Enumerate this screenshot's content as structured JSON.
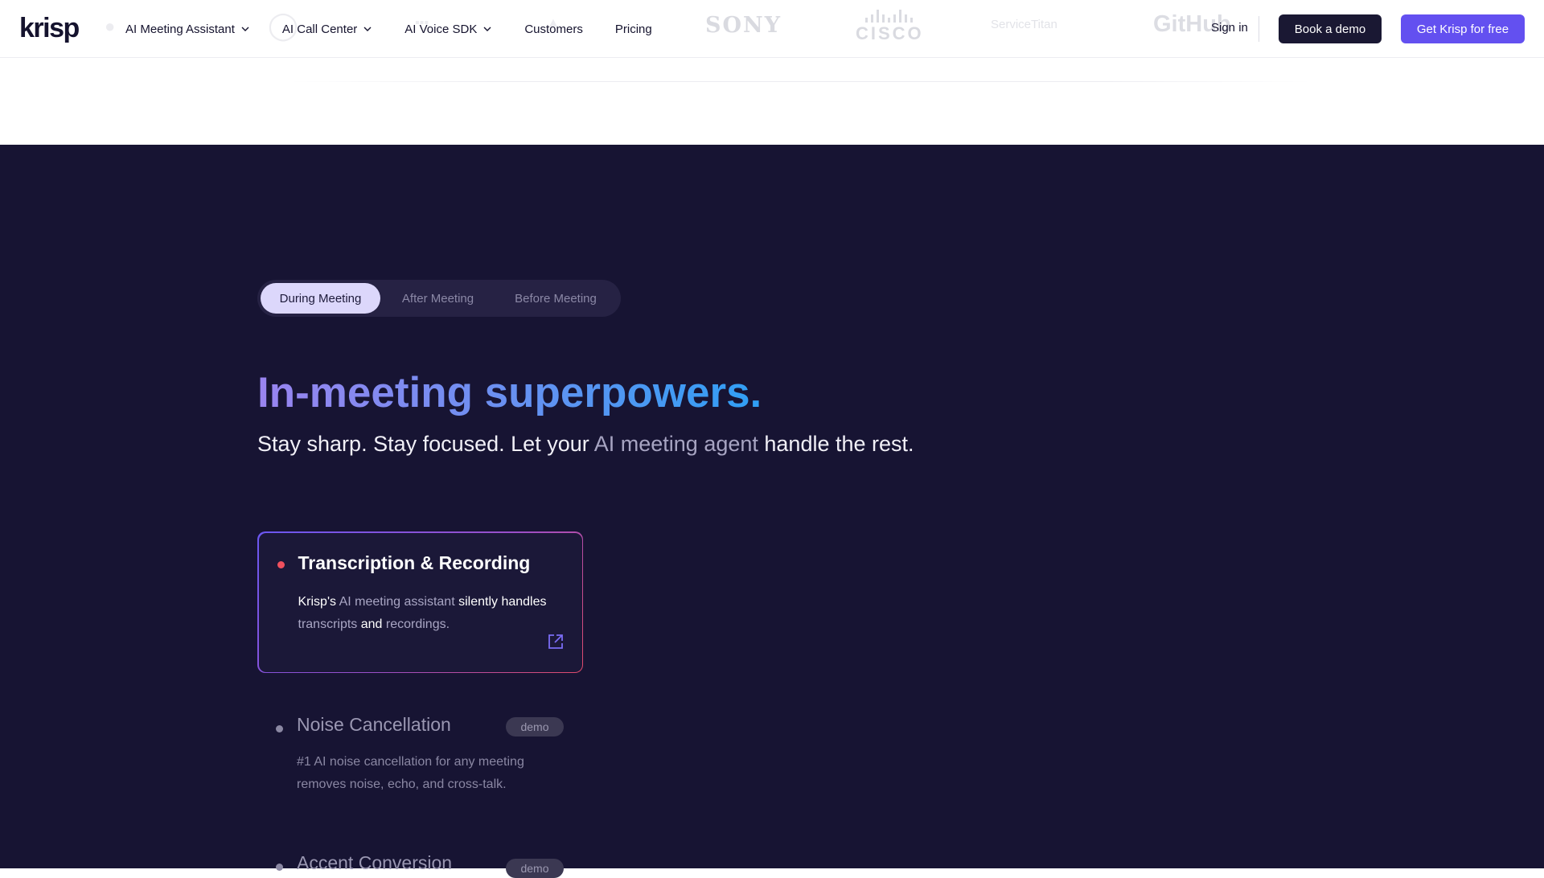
{
  "brand": {
    "logo": "krisp"
  },
  "nav": {
    "items": [
      {
        "label": "AI Meeting Assistant",
        "has_dropdown": true
      },
      {
        "label": "AI Call Center",
        "has_dropdown": true
      },
      {
        "label": "AI Voice SDK",
        "has_dropdown": true
      },
      {
        "label": "Customers",
        "has_dropdown": false
      },
      {
        "label": "Pricing",
        "has_dropdown": false
      }
    ],
    "sign_in": "Sign in",
    "book_demo": "Book a demo",
    "get_free": "Get Krisp for free"
  },
  "customer_logos": [
    "SONY",
    "CISCO",
    "ServiceTitan",
    "GitHub"
  ],
  "tabs": [
    {
      "label": "During Meeting",
      "active": true
    },
    {
      "label": "After Meeting",
      "active": false
    },
    {
      "label": "Before Meeting",
      "active": false
    }
  ],
  "hero": {
    "headline": "In-meeting superpowers.",
    "sub_1": "Stay sharp. Stay focused. Let your ",
    "sub_dim": "AI meeting agent",
    "sub_2": " handle the rest."
  },
  "features": [
    {
      "title": "Transcription & Recording",
      "desc_parts": [
        "Krisp's",
        " AI meeting assistant ",
        "silently handles",
        " transcripts ",
        "and",
        " recordings."
      ],
      "active": true,
      "icon": "external-link-icon"
    },
    {
      "title": "Noise Cancellation",
      "badge": "demo",
      "desc": "#1 AI noise cancellation for any meeting removes noise, echo, and cross-talk.",
      "active": false
    },
    {
      "title": "Accent Conversion",
      "badge": "demo",
      "active": false
    }
  ],
  "colors": {
    "dark_bg": "#171433",
    "accent_purple": "#6350f0",
    "demo_button": "#1a1833",
    "active_tab": "#dcd7fb",
    "active_dot": "#f0505e"
  }
}
